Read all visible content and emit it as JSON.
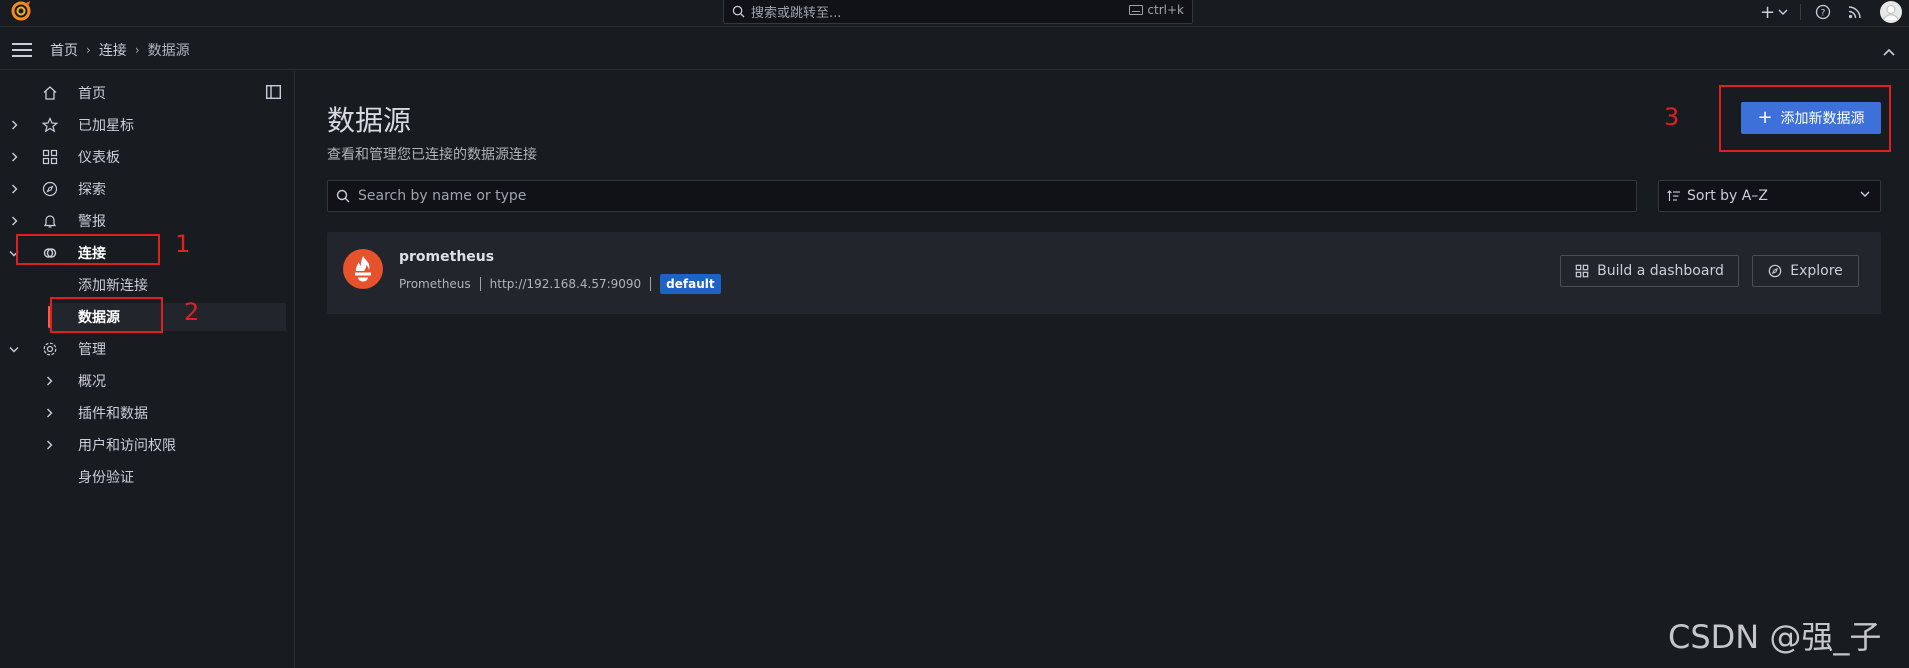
{
  "topbar": {
    "search_placeholder": "搜索或跳转至...",
    "search_shortcut": "ctrl+k"
  },
  "breadcrumb": [
    "首页",
    "连接",
    "数据源"
  ],
  "sidebar": {
    "items": [
      {
        "label": "首页",
        "icon": "home-icon"
      },
      {
        "label": "已加星标",
        "icon": "star-icon"
      },
      {
        "label": "仪表板",
        "icon": "apps-icon"
      },
      {
        "label": "探索",
        "icon": "compass-icon"
      },
      {
        "label": "警报",
        "icon": "bell-icon"
      },
      {
        "label": "连接",
        "icon": "link-icon"
      },
      {
        "label": "添加新连接"
      },
      {
        "label": "数据源"
      },
      {
        "label": "管理",
        "icon": "cog-icon"
      },
      {
        "label": "概况"
      },
      {
        "label": "插件和数据"
      },
      {
        "label": "用户和访问权限"
      },
      {
        "label": "身份验证"
      }
    ]
  },
  "main": {
    "title": "数据源",
    "subtitle": "查看和管理您已连接的数据源连接",
    "add_button": "添加新数据源",
    "search_placeholder": "Search by name or type",
    "sort_label": "Sort by A–Z"
  },
  "datasource": {
    "name": "prometheus",
    "type": "Prometheus",
    "url": "http://192.168.4.57:9090",
    "badge": "default",
    "build_button": "Build a dashboard",
    "explore_button": "Explore"
  },
  "annotations": [
    "1",
    "2",
    "3"
  ],
  "watermark": "CSDN @强_子",
  "colors": {
    "primary": "#3d71d9",
    "badge": "#1f62c6",
    "annotation": "#e02020",
    "active_bar": "#f55f3e"
  }
}
